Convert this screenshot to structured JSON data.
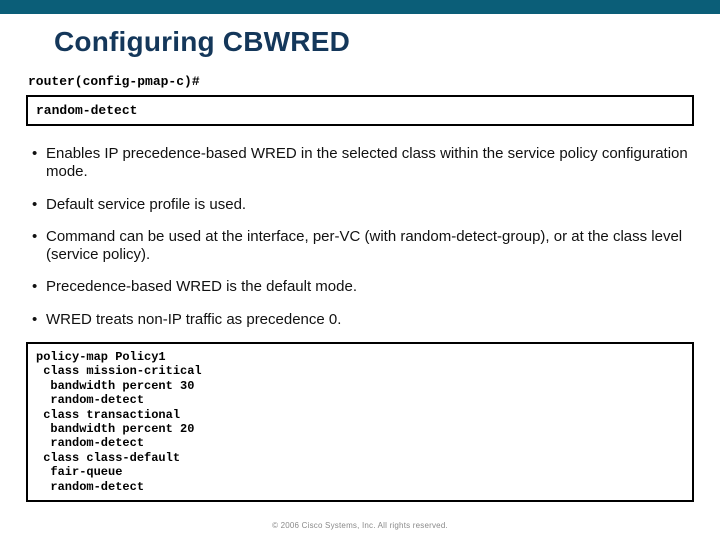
{
  "slide": {
    "title": "Configuring CBWRED",
    "prompt": "router(config-pmap-c)#",
    "command": "random-detect",
    "bullets": [
      "Enables IP precedence-based WRED in the selected class within the service policy configuration mode.",
      "Default service profile is used.",
      "Command can be used at the interface, per-VC (with random-detect-group), or at the class level (service policy).",
      "Precedence-based WRED is the default mode.",
      "WRED treats non-IP traffic as precedence 0."
    ],
    "code": "policy-map Policy1\n class mission-critical\n  bandwidth percent 30\n  random-detect\n class transactional\n  bandwidth percent 20\n  random-detect\n class class-default\n  fair-queue\n  random-detect",
    "footer": "© 2006 Cisco Systems, Inc. All rights reserved."
  }
}
